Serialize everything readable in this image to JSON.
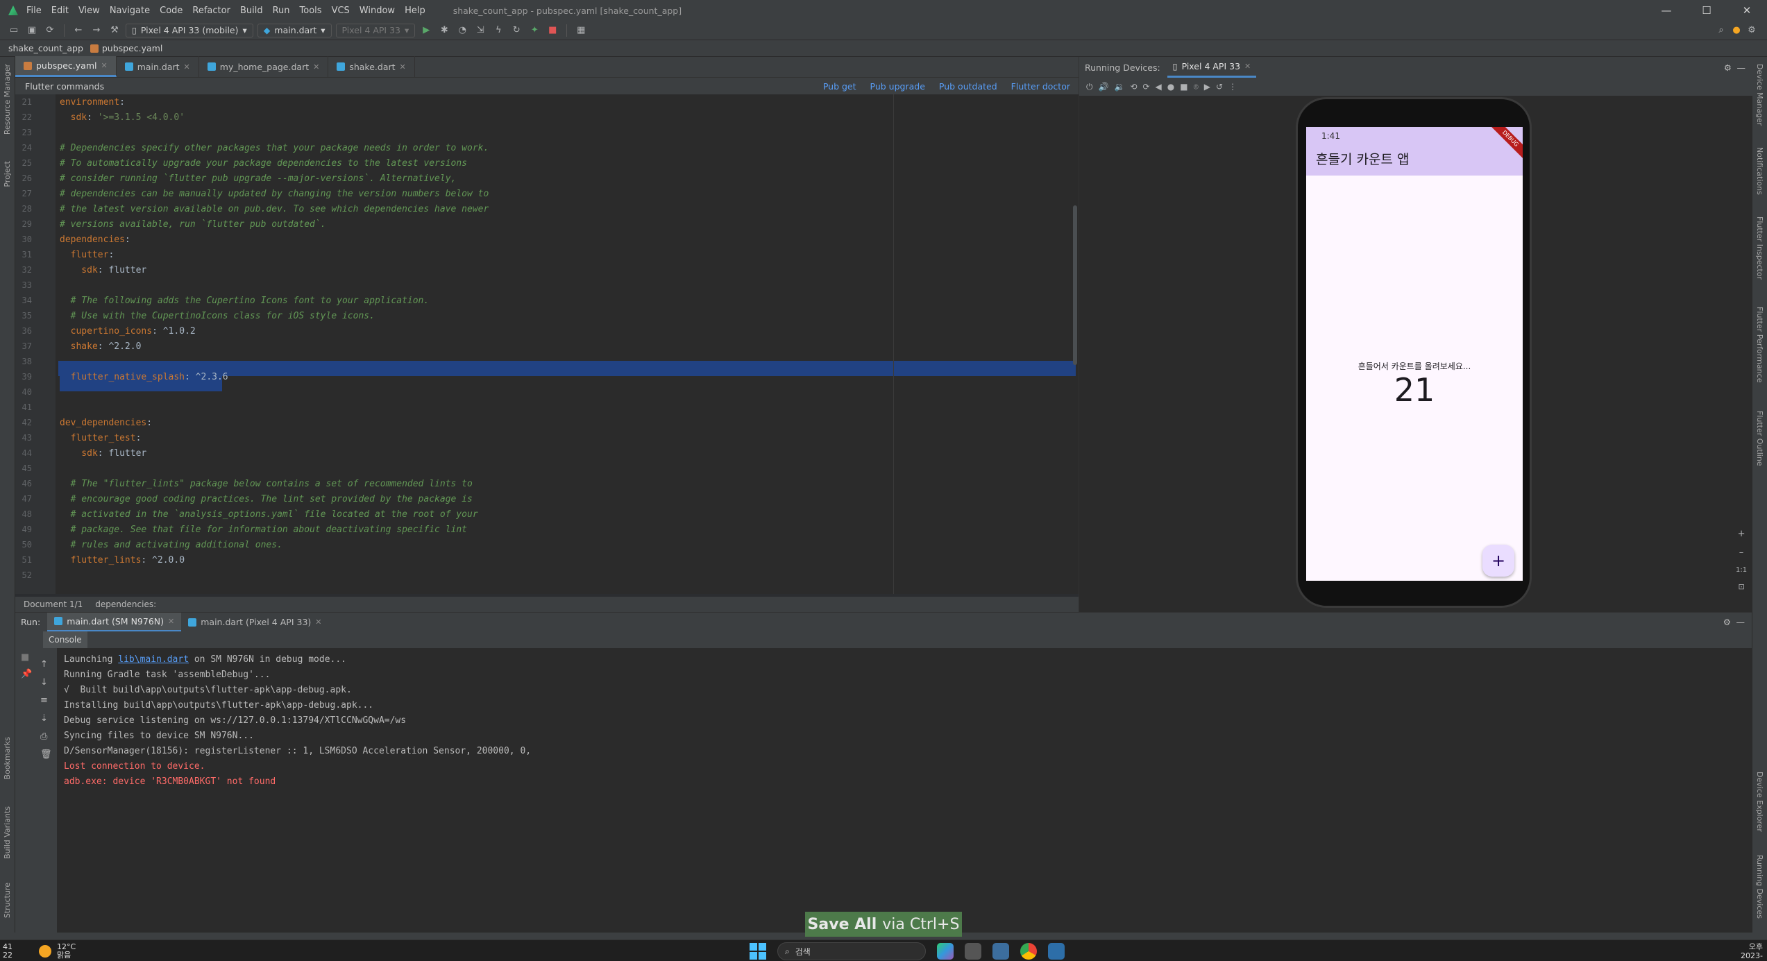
{
  "app": {
    "window_title": "shake_count_app - pubspec.yaml [shake_count_app]",
    "menu": [
      "File",
      "Edit",
      "View",
      "Navigate",
      "Code",
      "Refactor",
      "Build",
      "Run",
      "Tools",
      "VCS",
      "Window",
      "Help"
    ]
  },
  "toolbar": {
    "device_combo": "Pixel 4 API 33 (mobile)",
    "run_config": "main.dart",
    "secondary_device": "Pixel 4 API 33"
  },
  "breadcrumb": {
    "project": "shake_count_app",
    "file": "pubspec.yaml"
  },
  "editor_tabs": [
    {
      "label": "pubspec.yaml",
      "type": "yaml"
    },
    {
      "label": "main.dart",
      "type": "dart"
    },
    {
      "label": "my_home_page.dart",
      "type": "dart"
    },
    {
      "label": "shake.dart",
      "type": "dart"
    }
  ],
  "flutter_commands": {
    "title": "Flutter commands",
    "links": [
      "Pub get",
      "Pub upgrade",
      "Pub outdated",
      "Flutter doctor"
    ]
  },
  "editor_lines": [
    {
      "n": "21",
      "parts": [
        [
          "k",
          "environment"
        ],
        [
          "p",
          ":"
        ]
      ]
    },
    {
      "n": "22",
      "parts": [
        [
          "k",
          "  sdk"
        ],
        [
          "p",
          ": "
        ],
        [
          "s",
          "'>=3.1.5 <4.0.0'"
        ]
      ]
    },
    {
      "n": "23",
      "parts": []
    },
    {
      "n": "24",
      "parts": [
        [
          "c",
          "# Dependencies specify other packages that your package needs in order to work."
        ]
      ]
    },
    {
      "n": "25",
      "parts": [
        [
          "c",
          "# To automatically upgrade your package dependencies to the latest versions"
        ]
      ]
    },
    {
      "n": "26",
      "parts": [
        [
          "c",
          "# consider running `flutter pub upgrade --major-versions`. Alternatively,"
        ]
      ]
    },
    {
      "n": "27",
      "parts": [
        [
          "c",
          "# dependencies can be manually updated by changing the version numbers below to"
        ]
      ]
    },
    {
      "n": "28",
      "parts": [
        [
          "c",
          "# the latest version available on pub.dev. To see which dependencies have newer"
        ]
      ]
    },
    {
      "n": "29",
      "parts": [
        [
          "c",
          "# versions available, run `flutter pub outdated`."
        ]
      ]
    },
    {
      "n": "30",
      "parts": [
        [
          "k",
          "dependencies"
        ],
        [
          "p",
          ":"
        ]
      ]
    },
    {
      "n": "31",
      "parts": [
        [
          "k",
          "  flutter"
        ],
        [
          "p",
          ":"
        ]
      ]
    },
    {
      "n": "32",
      "parts": [
        [
          "k",
          "    sdk"
        ],
        [
          "p",
          ": flutter"
        ]
      ]
    },
    {
      "n": "33",
      "parts": []
    },
    {
      "n": "34",
      "parts": [
        [
          "c",
          "  # The following adds the Cupertino Icons font to your application."
        ]
      ]
    },
    {
      "n": "35",
      "parts": [
        [
          "c",
          "  # Use with the CupertinoIcons class for iOS style icons."
        ]
      ]
    },
    {
      "n": "36",
      "parts": [
        [
          "k",
          "  cupertino_icons"
        ],
        [
          "p",
          ": ^1.0.2"
        ]
      ]
    },
    {
      "n": "37",
      "parts": [
        [
          "k",
          "  shake"
        ],
        [
          "p",
          ": ^2.2.0"
        ]
      ]
    },
    {
      "n": "38",
      "parts": []
    },
    {
      "n": "39",
      "parts": [
        [
          "k",
          "  flutter_native_splash"
        ],
        [
          "p",
          ": ^2.3.6"
        ]
      ]
    },
    {
      "n": "40",
      "parts": []
    },
    {
      "n": "41",
      "parts": []
    },
    {
      "n": "42",
      "parts": [
        [
          "k",
          "dev_dependencies"
        ],
        [
          "p",
          ":"
        ]
      ]
    },
    {
      "n": "43",
      "parts": [
        [
          "k",
          "  flutter_test"
        ],
        [
          "p",
          ":"
        ]
      ]
    },
    {
      "n": "44",
      "parts": [
        [
          "k",
          "    sdk"
        ],
        [
          "p",
          ": flutter"
        ]
      ]
    },
    {
      "n": "45",
      "parts": []
    },
    {
      "n": "46",
      "parts": [
        [
          "c",
          "  # The \"flutter_lints\" package below contains a set of recommended lints to"
        ]
      ]
    },
    {
      "n": "47",
      "parts": [
        [
          "c",
          "  # encourage good coding practices. The lint set provided by the package is"
        ]
      ]
    },
    {
      "n": "48",
      "parts": [
        [
          "c",
          "  # activated in the `analysis_options.yaml` file located at the root of your"
        ]
      ]
    },
    {
      "n": "49",
      "parts": [
        [
          "c",
          "  # package. See that file for information about deactivating specific lint"
        ]
      ]
    },
    {
      "n": "50",
      "parts": [
        [
          "c",
          "  # rules and activating additional ones."
        ]
      ]
    },
    {
      "n": "51",
      "parts": [
        [
          "k",
          "  flutter_lints"
        ],
        [
          "p",
          ": ^2.0.0"
        ]
      ]
    },
    {
      "n": "52",
      "parts": []
    }
  ],
  "editor_status": {
    "document": "Document 1/1",
    "path": "dependencies:"
  },
  "running_devices": {
    "label": "Running Devices:",
    "device_tab": "Pixel 4 API 33",
    "phone": {
      "status_time": "1:41",
      "app_title": "흔들기 카운트 앱",
      "debug_banner": "DEBUG",
      "hint": "흔들어서 카운트를 올려보세요...",
      "count": "21",
      "fab": "+"
    },
    "zoom": [
      "+",
      "–",
      "1:1"
    ]
  },
  "run_panel": {
    "label": "Run:",
    "tabs": [
      "main.dart (SM N976N)",
      "main.dart (Pixel 4 API 33)"
    ],
    "console_tab": "Console"
  },
  "console": {
    "launching_prefix": "Launching ",
    "launching_link": "lib\\main.dart",
    "launching_suffix": " on SM N976N in debug mode...",
    "lines": [
      {
        "text": "Running Gradle task 'assembleDebug'...",
        "error": false
      },
      {
        "text": "√  Built build\\app\\outputs\\flutter-apk\\app-debug.apk.",
        "error": false
      },
      {
        "text": "Installing build\\app\\outputs\\flutter-apk\\app-debug.apk...",
        "error": false
      },
      {
        "text": "Debug service listening on ws://127.0.0.1:13794/XTlCCNwGQwA=/ws",
        "error": false
      },
      {
        "text": "Syncing files to device SM N976N...",
        "error": false
      },
      {
        "text": "D/SensorManager(18156): registerListener :: 1, LSM6DSO Acceleration Sensor, 200000, 0,",
        "error": false
      },
      {
        "text": "Lost connection to device.",
        "error": true
      },
      {
        "text": "adb.exe: device 'R3CMB0ABKGT' not found",
        "error": true
      }
    ]
  },
  "toast": {
    "bold": "Save All",
    "rest": "via Ctrl+S"
  },
  "side_labels": {
    "left": [
      "Resource Manager",
      "Project",
      "Bookmarks",
      "Build Variants",
      "Structure"
    ],
    "right": [
      "Device Manager",
      "Notifications",
      "Flutter Inspector",
      "Flutter Performance",
      "Flutter Outline",
      "Device Explorer",
      "Running Devices"
    ]
  },
  "taskbar": {
    "temp": "12°C",
    "weather": "맑음",
    "search": "검색",
    "clock_left": "41",
    "clock_left2": "22",
    "clock_right": "오후",
    "clock_right2": "2023-"
  }
}
